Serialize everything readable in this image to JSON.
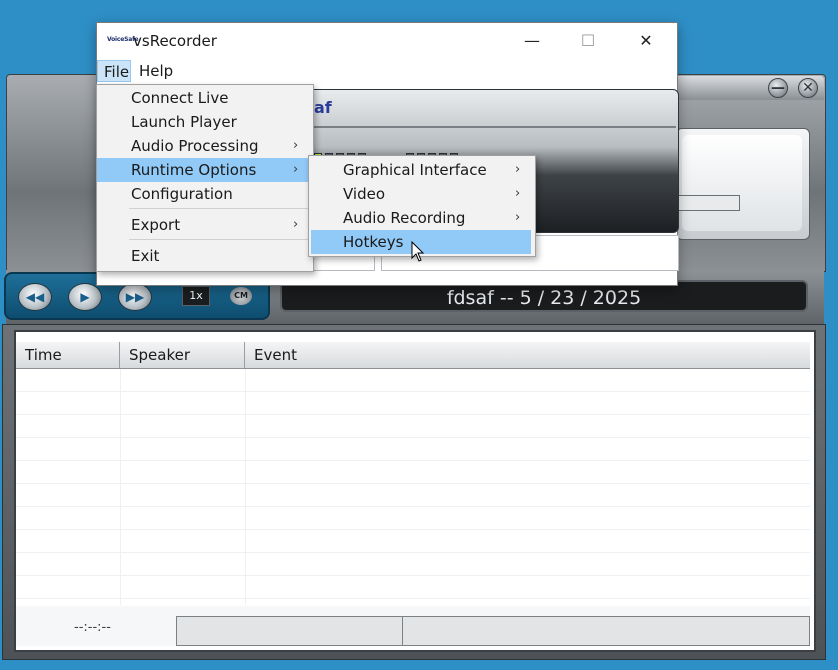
{
  "window": {
    "title": "vsRecorder",
    "logo_text": "VoiceSafe",
    "minimize_glyph": "—",
    "maximize_glyph": "☐",
    "close_glyph": "✕"
  },
  "menubar": {
    "file": "File",
    "help": "Help"
  },
  "file_menu": [
    {
      "label": "Connect Live",
      "submenu": false
    },
    {
      "label": "Launch Player",
      "submenu": false
    },
    {
      "label": "Audio Processing",
      "submenu": true
    },
    {
      "label": "Runtime Options",
      "submenu": true,
      "highlighted": true
    },
    {
      "label": "Configuration",
      "submenu": false
    },
    {
      "label": "Export",
      "submenu": true
    },
    {
      "label": "Exit",
      "submenu": false
    }
  ],
  "runtime_submenu": [
    {
      "label": "Graphical Interface",
      "submenu": true
    },
    {
      "label": "Video",
      "submenu": true
    },
    {
      "label": "Audio Recording",
      "submenu": true
    },
    {
      "label": "Hotkeys",
      "submenu": false,
      "highlighted": true
    }
  ],
  "lcd": {
    "name_fragment": "af"
  },
  "transport": {
    "rewind_glyph": "◀◀",
    "play_glyph": "▶",
    "ffwd_glyph": "▶▶",
    "speed": "1x",
    "cm": "CM"
  },
  "session_display": "fdsaf  --  5 / 23 / 2025",
  "event_list": {
    "columns": [
      "Time",
      "Speaker",
      "Event"
    ],
    "status_time": "--:--:--"
  },
  "skin_buttons": {
    "minimize": "—",
    "close": "✕"
  },
  "colors": {
    "desktop": "#2e8fc6",
    "menu_highlight": "#91c9f7",
    "lcd_text": "#2b3c9b",
    "level_on": "#b8e23d"
  }
}
